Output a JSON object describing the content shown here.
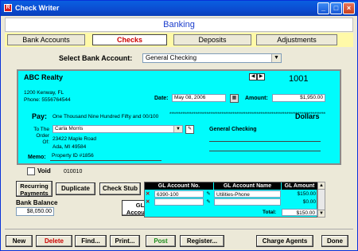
{
  "window": {
    "title": "Check Writer",
    "min": "_",
    "max": "□",
    "close": "×"
  },
  "header": {
    "title": "Banking"
  },
  "tabs": [
    "Bank Accounts",
    "Checks",
    "Deposits",
    "Adjustments"
  ],
  "select_account": {
    "label": "Select Bank Account:",
    "value": "General Checking"
  },
  "check": {
    "payee_company": "ABC Realty",
    "number": "1001",
    "address_line1": "1200 Kenway, FL",
    "phone": "Phone: 5556764544",
    "date_label": "Date:",
    "date": "May 08, 2006",
    "amount_label": "Amount:",
    "amount": "$1,950.00",
    "pay_label": "Pay:",
    "pay_words": "One Thousand Nine Hundred Fifty and 00/100",
    "dollars_label": "Dollars",
    "order_label": "To The Order Of:",
    "order_name": "Carla Morris",
    "order_addr1": "23422 Maple Road",
    "order_addr2": "Ada, MI 49584",
    "bank_name": "General Checking",
    "memo_label": "Memo:",
    "memo": "Property ID #1856"
  },
  "void": {
    "label": "Void",
    "micr": "010010"
  },
  "buttons": {
    "recurring": "Recurring Payments",
    "duplicate": "Duplicate",
    "check_stub": "Check Stub",
    "gl_accounts": "GL Accounts"
  },
  "bank_balance": {
    "label": "Bank Balance",
    "value": "$8,050.00"
  },
  "gl_table": {
    "headers": [
      "GL Account No.",
      "GL Account Name",
      "GL Amount"
    ],
    "rows": [
      {
        "no": "6390-100",
        "name": "Utilities-Phone",
        "amount": "$150.00"
      },
      {
        "no": "",
        "name": "",
        "amount": "$0.00"
      }
    ],
    "total_label": "Total:",
    "total": "$150.00"
  },
  "bottom": {
    "new": "New",
    "delete": "Delete",
    "find": "Find...",
    "print": "Print...",
    "post": "Post",
    "register": "Register...",
    "charge_agents": "Charge Agents",
    "done": "Done"
  },
  "colors": {
    "check_bg": "#00fcfc",
    "tab_bar": "#fff9a8",
    "accent": "#1a3ccc"
  }
}
